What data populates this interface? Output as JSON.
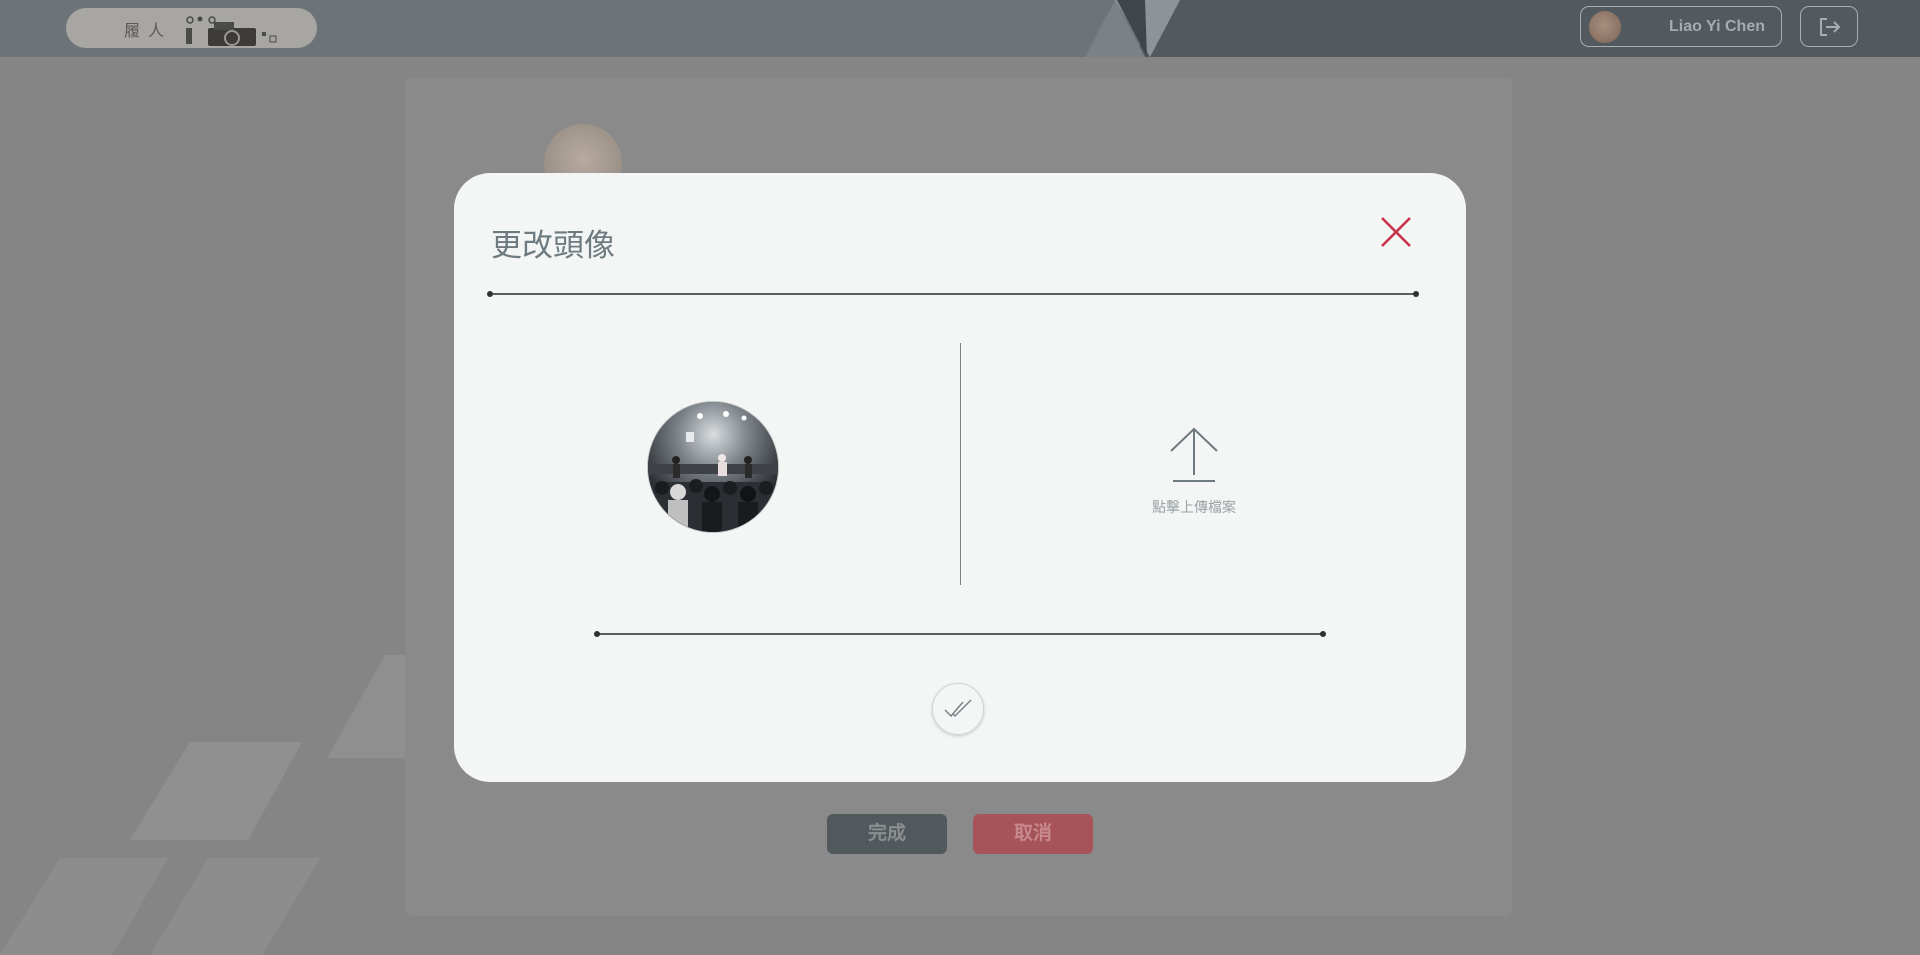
{
  "header": {
    "logo_text": "履人",
    "user_name": "Liao Yi Chen"
  },
  "background_page": {
    "done_label": "完成",
    "cancel_label": "取消"
  },
  "modal": {
    "title": "更改頭像",
    "upload_label": "點擊上傳檔案"
  },
  "icons": [
    "camera-icon",
    "logout-icon",
    "close-icon",
    "upload-arrow-icon",
    "double-check-icon"
  ],
  "colors": {
    "close_icon": "#c8344a",
    "modal_background": "#f4f6f5",
    "done_button": "#52595d",
    "cancel_button": "#a65459"
  }
}
